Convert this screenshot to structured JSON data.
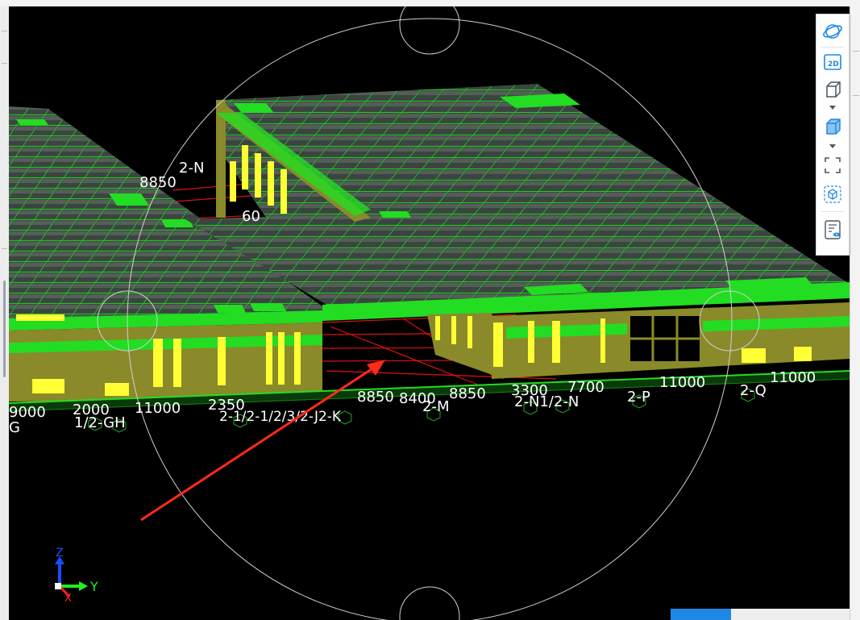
{
  "colors": {
    "viewport_bg": "#000000",
    "roof": "#36413b",
    "roof_grid": "#19c919",
    "beam": "#22dd22",
    "wall": "#8a8a2a",
    "window": "#ffff33",
    "grid_line": "#e01010",
    "label": "#ffffff",
    "arrow": "#ff2a1a",
    "axis_z": "#1a4cff",
    "axis_y": "#22ee22",
    "axis_x": "#ff2222",
    "accent": "#1e88e5"
  },
  "toolbar": {
    "items": [
      {
        "id": "orbit",
        "icon": "orbit-icon"
      },
      {
        "id": "view2d",
        "icon": "view-2d-icon",
        "label": "2D"
      },
      {
        "id": "wireframe",
        "icon": "wireframe-cube-icon"
      },
      {
        "id": "solid",
        "icon": "solid-cube-icon"
      },
      {
        "id": "fit",
        "icon": "fit-view-icon"
      },
      {
        "id": "isolate",
        "icon": "isolate-cube-icon"
      },
      {
        "id": "properties",
        "icon": "view-properties-icon"
      }
    ]
  },
  "grid_labels": {
    "top": [
      {
        "text": "2-N"
      },
      {
        "text": "8850"
      },
      {
        "text": "60"
      }
    ],
    "dims": [
      {
        "text": "2000"
      },
      {
        "text": "11000"
      },
      {
        "text": "2350"
      },
      {
        "text": "8850"
      },
      {
        "text": "8400"
      },
      {
        "text": "8850"
      },
      {
        "text": "3300"
      },
      {
        "text": "7700"
      },
      {
        "text": "11000"
      },
      {
        "text": "11000"
      }
    ],
    "axes": [
      {
        "text": "9000"
      },
      {
        "text": "1/2-GH"
      },
      {
        "text": "2-1/2-1/2/3/2-J2-K"
      },
      {
        "text": "2-M"
      },
      {
        "text": "2-N1/2-N"
      },
      {
        "text": "2-P"
      },
      {
        "text": "2-Q"
      },
      {
        "text": "G"
      }
    ]
  },
  "triad": {
    "z": "Z",
    "y": "Y",
    "x": "X"
  }
}
